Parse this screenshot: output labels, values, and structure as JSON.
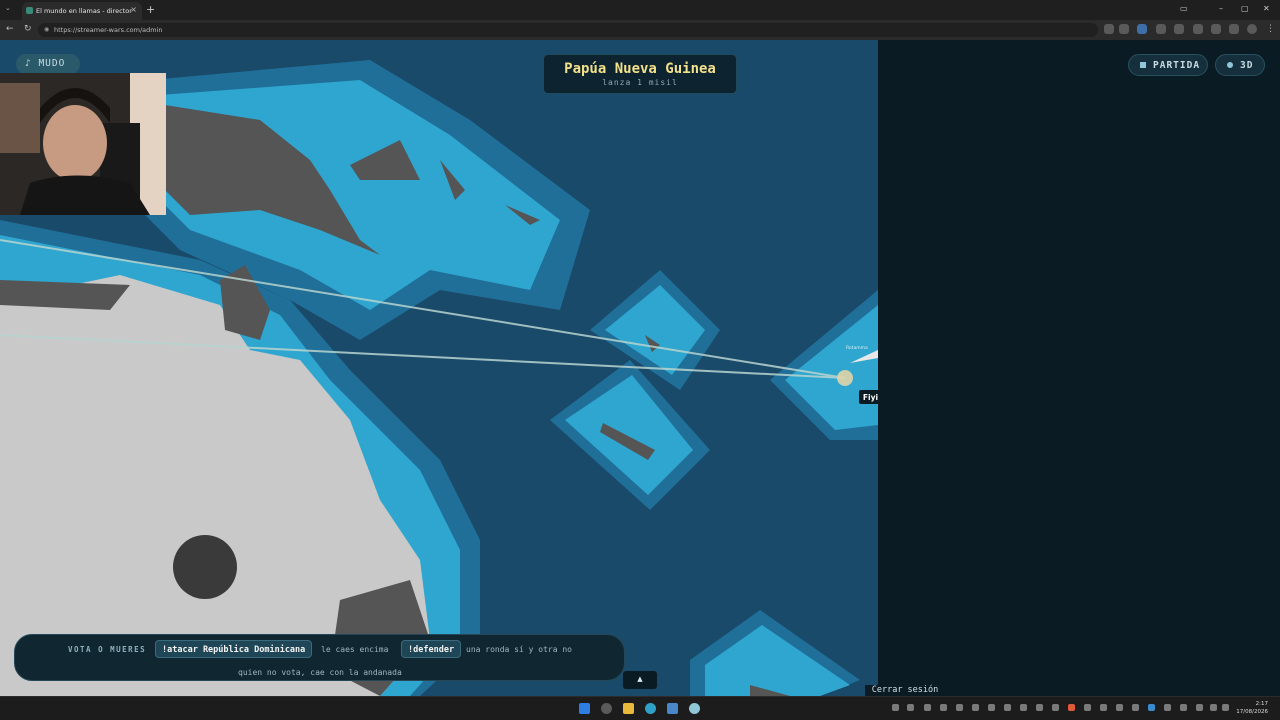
{
  "browser": {
    "tab_title": "El mundo en llamas - director",
    "tab_close": "×",
    "new_tab": "+",
    "url": "https://streamer-wars.com/admin"
  },
  "hud": {
    "mute_label": "♪ MUDO",
    "country_title": "Papúa Nueva Guinea",
    "country_action": "lanza 1 misil",
    "match_label": "PARTIDA",
    "view_3d_label": "3D"
  },
  "map": {
    "target_label": "Fiyi",
    "target_small_label": "Rotamma"
  },
  "vote": {
    "heading": "VOTA O MUERES",
    "attack_command": "!atacar República Dominicana",
    "attack_desc": "le caes encima",
    "defend_command": "!defender",
    "defend_desc": "una ronda sí y otra no",
    "footnote": "quien no vota, cae con la andanada",
    "expand_label": "▲"
  },
  "session": {
    "logout_label": "Cerrar sesión"
  },
  "taskbar": {
    "time": "2:17",
    "date": "17/08/2026"
  },
  "colors": {
    "ocean": "#1a4a6a",
    "shallow": "#2ea6cf",
    "shelf": "#1f6f99",
    "land": "#c9c9c9",
    "land_dark": "#555555",
    "title_accent": "#f2e08a"
  }
}
